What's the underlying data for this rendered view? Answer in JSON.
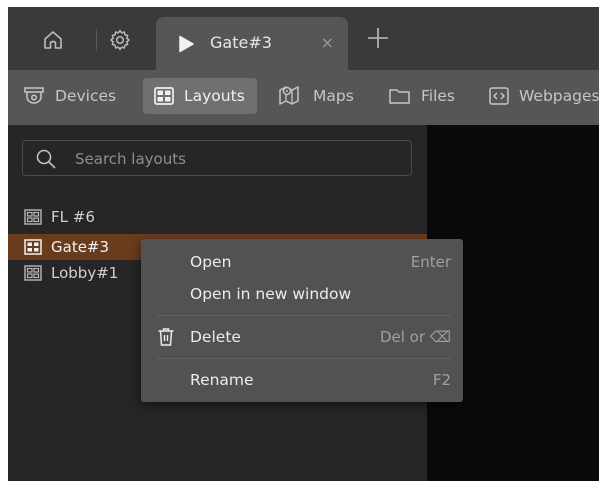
{
  "tabbar": {
    "home_icon": "home-icon",
    "settings_icon": "gear-icon",
    "active_tab": {
      "label": "Gate#3",
      "icon": "play-icon",
      "close_glyph": "×"
    },
    "add_icon": "plus-icon"
  },
  "nav": {
    "items": [
      {
        "label": "Devices",
        "icon": "camera-icon"
      },
      {
        "label": "Layouts",
        "icon": "layout-icon"
      },
      {
        "label": "Maps",
        "icon": "map-icon"
      },
      {
        "label": "Files",
        "icon": "folder-icon"
      },
      {
        "label": "Webpages",
        "icon": "code-icon"
      }
    ],
    "active": "Layouts"
  },
  "search": {
    "placeholder": "Search layouts"
  },
  "layouts": [
    {
      "label": "FL #6"
    },
    {
      "label": "Gate#3"
    },
    {
      "label": "Lobby#1"
    }
  ],
  "selected_layout": "Gate#3",
  "context_menu": {
    "items": [
      {
        "label": "Open",
        "shortcut": "Enter"
      },
      {
        "label": "Open in new window",
        "shortcut": ""
      },
      {
        "label": "Delete",
        "shortcut": "Del or ⌫",
        "icon": "trash-icon"
      },
      {
        "label": "Rename",
        "shortcut": "F2"
      }
    ]
  },
  "colors": {
    "selection": "#6a3c1e",
    "tabbar": "#3a3a3a",
    "navbar": "#565656",
    "panel": "#262626",
    "menu": "#525252"
  }
}
